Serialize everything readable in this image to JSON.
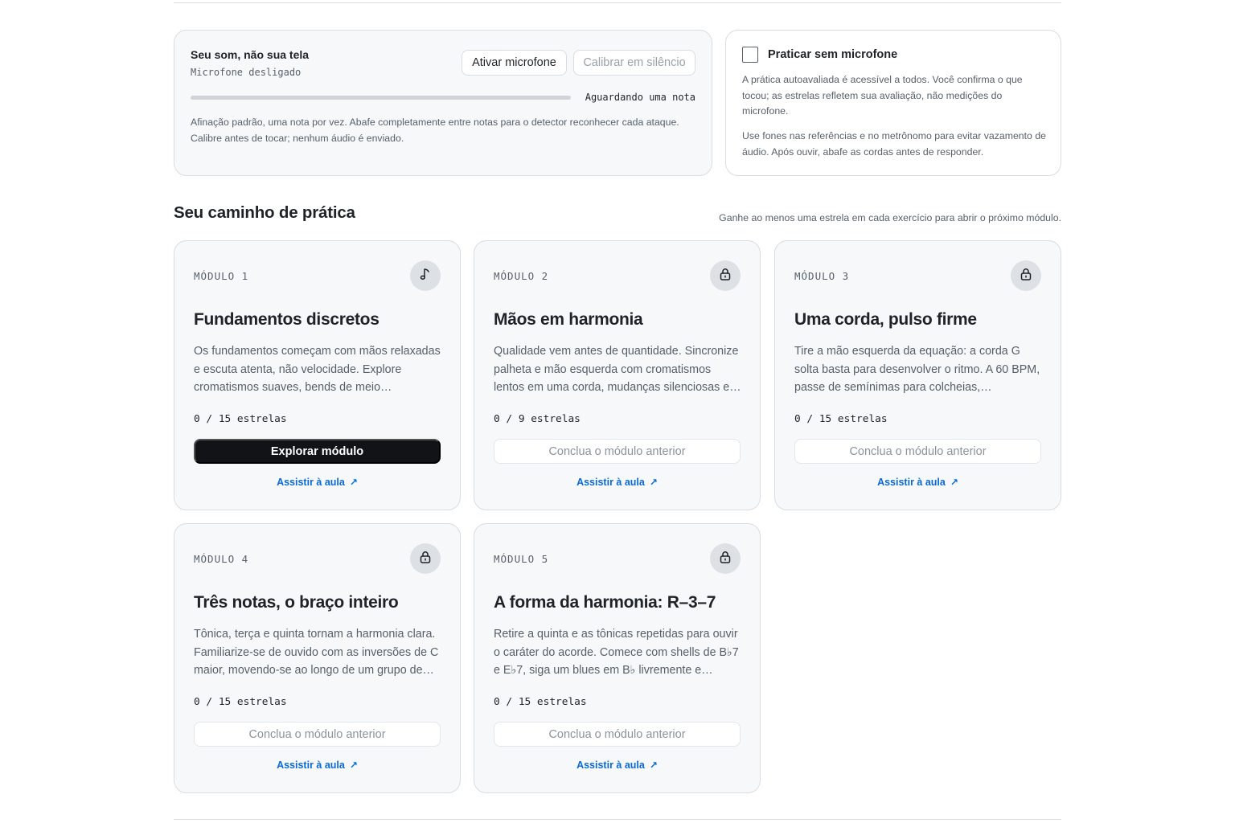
{
  "mic": {
    "title": "Seu som, não sua tela",
    "status": "Microfone desligado",
    "activate_label": "Ativar microfone",
    "calibrate_label": "Calibrar em silêncio",
    "meter_level": 0,
    "meter_label": "Aguardando uma nota",
    "note": "Afinação padrão, uma nota por vez. Abafe completamente entre notas para o detector reconhecer cada ataque. Calibre antes de tocar; nenhum áudio é enviado."
  },
  "no_mic": {
    "label": "Praticar sem microfone",
    "checked": false,
    "p1": "A prática autoavaliada é acessível a todos. Você confirma o que tocou; as estrelas refletem sua avaliação, não medições do microfone.",
    "p2": "Use fones nas referências e no metrônomo para evitar vazamento de áudio. Após ouvir, abafe as cordas antes de responder."
  },
  "path": {
    "title": "Seu caminho de prática",
    "hint": "Ganhe ao menos uma estrela em cada exercício para abrir o próximo módulo."
  },
  "modules": [
    {
      "eyebrow": "MÓDULO 1",
      "icon": "music-note-icon",
      "title": "Fundamentos discretos",
      "desc": "Os fundamentos começam com mãos relaxadas e escuta atenta, não velocidade. Explore cromatismos suaves, bends de meio…",
      "stars": "0 / 15 estrelas",
      "action": "Explorar módulo",
      "locked": false,
      "link": "Assistir à aula",
      "link_arrow": "↗"
    },
    {
      "eyebrow": "MÓDULO 2",
      "icon": "lock-icon",
      "title": "Mãos em harmonia",
      "desc": "Qualidade vem antes de quantidade. Sincronize palheta e mão esquerda com cromatismos lentos em uma corda, mudanças silenciosas e…",
      "stars": "0 / 9 estrelas",
      "action": "Conclua o módulo anterior",
      "locked": true,
      "link": "Assistir à aula",
      "link_arrow": "↗"
    },
    {
      "eyebrow": "MÓDULO 3",
      "icon": "lock-icon",
      "title": "Uma corda, pulso firme",
      "desc": "Tire a mão esquerda da equação: a corda G solta basta para desenvolver o ritmo. A 60 BPM, passe de semínimas para colcheias,…",
      "stars": "0 / 15 estrelas",
      "action": "Conclua o módulo anterior",
      "locked": true,
      "link": "Assistir à aula",
      "link_arrow": "↗"
    },
    {
      "eyebrow": "MÓDULO 4",
      "icon": "lock-icon",
      "title": "Três notas, o braço inteiro",
      "desc": "Tônica, terça e quinta tornam a harmonia clara. Familiarize-se de ouvido com as inversões de C maior, movendo-se ao longo de um grupo de…",
      "stars": "0 / 15 estrelas",
      "action": "Conclua o módulo anterior",
      "locked": true,
      "link": "Assistir à aula",
      "link_arrow": "↗"
    },
    {
      "eyebrow": "MÓDULO 5",
      "icon": "lock-icon",
      "title": "A forma da harmonia: R–3–7",
      "desc": "Retire a quinta e as tônicas repetidas para ouvir o caráter do acorde. Comece com shells de B♭7 e E♭7, siga um blues em B♭ livremente e depois…",
      "stars": "0 / 15 estrelas",
      "action": "Conclua o módulo anterior",
      "locked": true,
      "link": "Assistir à aula",
      "link_arrow": "↗"
    }
  ]
}
